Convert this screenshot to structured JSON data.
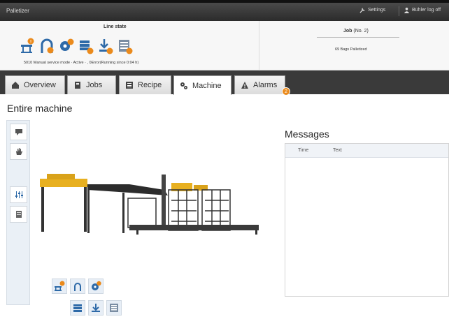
{
  "titlebar": {
    "app_name": "Palletizer",
    "settings_label": "Settings",
    "user_label": "Bühler log off"
  },
  "line_state": {
    "title": "Line state",
    "mode_text": "5010 Manual service mode · Active · , 0Error(Running since 0:04 h)",
    "icons": [
      "palletizer-warning-icon",
      "gripper-warning-icon",
      "gear-warning-icon",
      "layer-warning-icon",
      "download-warning-icon",
      "stack-warning-icon"
    ]
  },
  "job": {
    "title": "Job",
    "number": "(No. 2)",
    "bags_text": "69 Bags Palletized"
  },
  "tabs": [
    {
      "label": "Overview",
      "icon": "home-icon"
    },
    {
      "label": "Jobs",
      "icon": "document-icon"
    },
    {
      "label": "Recipe",
      "icon": "recipe-icon"
    },
    {
      "label": "Machine",
      "icon": "cogs-icon"
    },
    {
      "label": "Alarms",
      "icon": "warning-icon",
      "badge": "2"
    }
  ],
  "page_title": "Entire machine",
  "sidebar": [
    "comment-icon",
    "hand-icon",
    "blank",
    "sliders-icon",
    "list-icon"
  ],
  "messages": {
    "title": "Messages",
    "columns": [
      "Time",
      "Text"
    ]
  },
  "colors": {
    "accent_orange": "#ea8a1c",
    "machine_yellow": "#e8b020",
    "tab_bar": "#3a3a3a",
    "icon_blue": "#2e6aa8"
  }
}
